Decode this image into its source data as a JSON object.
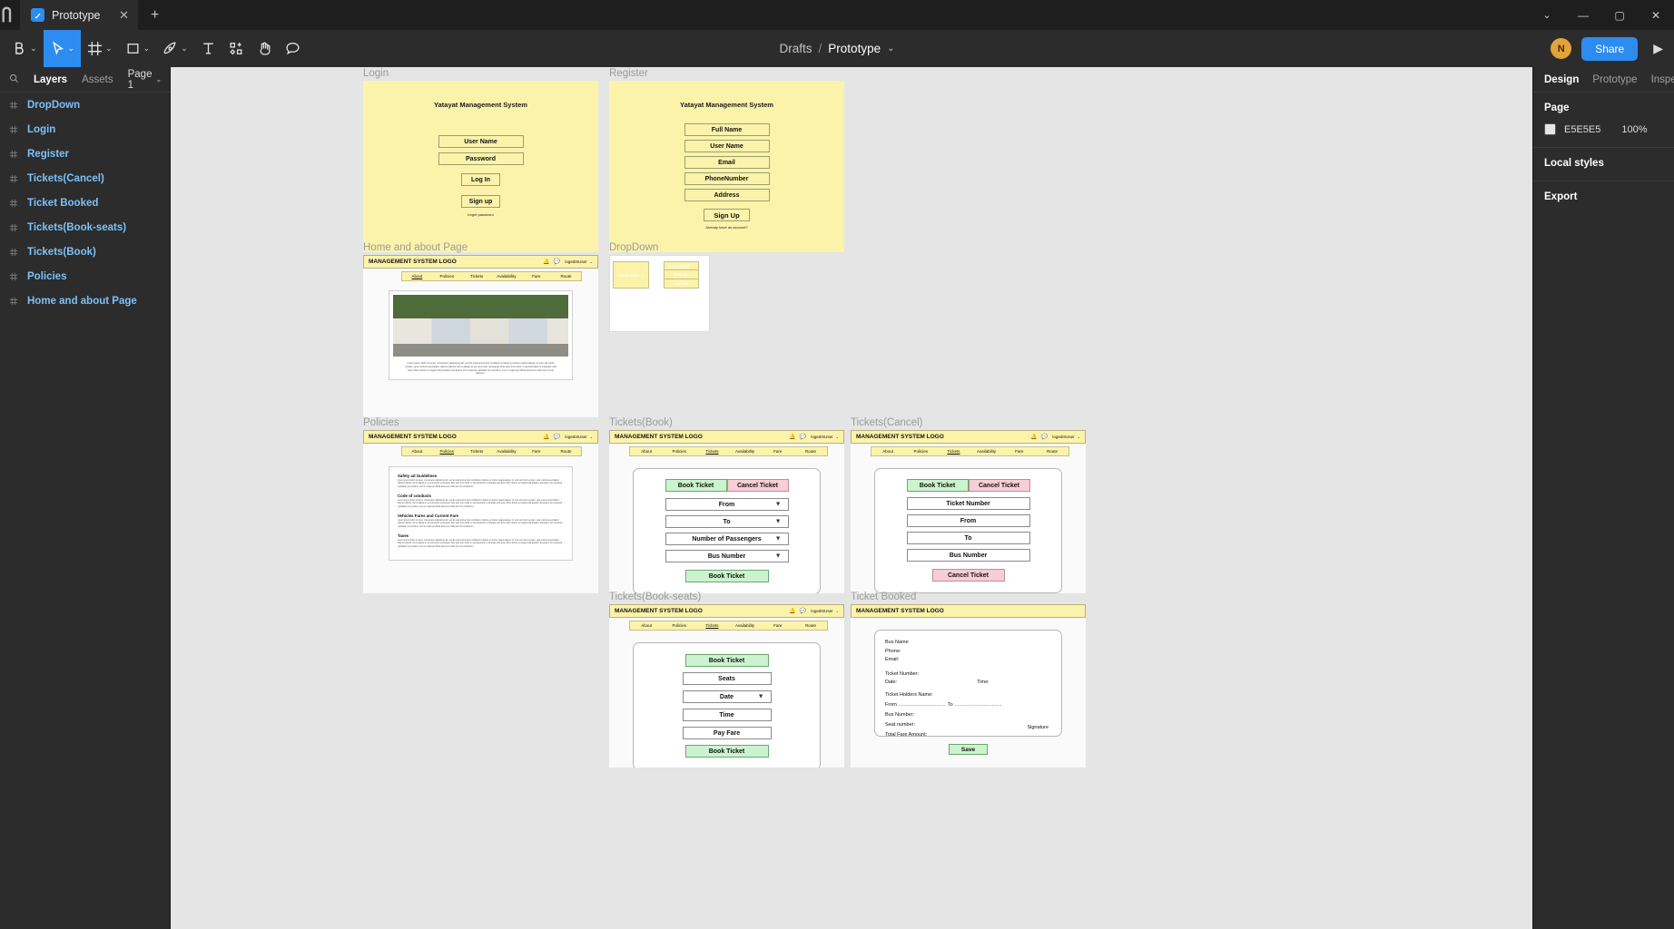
{
  "window": {
    "tab_title": "Prototype",
    "tab_icon": "figma-file-icon",
    "new_tab_icon": "plus-icon",
    "chevron_icon": "chevron-down-icon",
    "minimize_icon": "minimize-icon",
    "maximize_icon": "maximize-icon",
    "close_icon": "close-icon"
  },
  "toolbar": {
    "tools": [
      {
        "name": "move-tool",
        "icon": "cursor-icon",
        "active": true,
        "caret": true
      },
      {
        "name": "frame-tool",
        "icon": "frame-icon",
        "active": false,
        "caret": true
      },
      {
        "name": "shape-tool",
        "icon": "square-icon",
        "active": false,
        "caret": true
      },
      {
        "name": "pen-tool",
        "icon": "pen-icon",
        "active": false,
        "caret": true
      },
      {
        "name": "text-tool",
        "icon": "text-icon",
        "active": false,
        "caret": false
      },
      {
        "name": "component-tool",
        "icon": "components-icon",
        "active": false,
        "caret": false
      },
      {
        "name": "hand-tool",
        "icon": "hand-icon",
        "active": false,
        "caret": false
      },
      {
        "name": "comment-tool",
        "icon": "comment-icon",
        "active": false,
        "caret": false
      }
    ],
    "breadcrumb_root": "Drafts",
    "breadcrumb_sep": "/",
    "breadcrumb_file": "Prototype",
    "avatar_initial": "N",
    "share_label": "Share",
    "present_icon": "play-icon"
  },
  "left_panel": {
    "search_icon": "search-icon",
    "tabs": [
      {
        "label": "Layers",
        "selected": true
      },
      {
        "label": "Assets",
        "selected": false
      }
    ],
    "page_label": "Page 1",
    "layers": [
      {
        "label": "DropDown",
        "icon": "frame-icon"
      },
      {
        "label": "Login",
        "icon": "frame-icon"
      },
      {
        "label": "Register",
        "icon": "frame-icon"
      },
      {
        "label": "Tickets(Cancel)",
        "icon": "frame-icon"
      },
      {
        "label": "Ticket Booked",
        "icon": "frame-icon"
      },
      {
        "label": "Tickets(Book-seats)",
        "icon": "frame-icon"
      },
      {
        "label": "Tickets(Book)",
        "icon": "frame-icon"
      },
      {
        "label": "Policies",
        "icon": "frame-icon"
      },
      {
        "label": "Home and about Page",
        "icon": "frame-icon"
      }
    ]
  },
  "right_panel": {
    "tabs": [
      {
        "label": "Design",
        "selected": true
      },
      {
        "label": "Prototype",
        "selected": false
      },
      {
        "label": "Inspect",
        "selected": false
      }
    ],
    "page_heading": "Page",
    "page_color_hex": "E5E5E5",
    "page_color_value": "#E5E5E5",
    "page_opacity": "100%",
    "local_styles_heading": "Local styles",
    "export_heading": "Export"
  },
  "canvas": {
    "background": "#E5E5E5",
    "frames": {
      "login": {
        "label": "Login",
        "title": "Yatayat Management System",
        "fields": [
          "User Name",
          "Password"
        ],
        "login_button": "Log In",
        "signup_button": "Sign up",
        "forgot_link": "forget password"
      },
      "register": {
        "label": "Register",
        "title": "Yatayat Management System",
        "fields": [
          "Full Name",
          "User Name",
          "Email",
          "PhoneNumber",
          "Address"
        ],
        "signup_button": "Sign Up",
        "note": "Already have an account?"
      },
      "dropdown": {
        "label": "DropDown",
        "user_chip": "logedInUser",
        "user_chip_open": "logedInUser",
        "menu_items": [
          "Settings",
          "Log Out"
        ],
        "chevron_down_icon": "chevron-down-icon",
        "chevron_up_icon": "chevron-up-icon"
      },
      "home": {
        "label": "Home and about Page",
        "logo": "MANAGEMENT SYSTEM LOGO",
        "user": "logedInUser",
        "bell_icon": "bell-icon",
        "message_icon": "message-icon",
        "menu": [
          "About",
          "Policies",
          "Tickets",
          "Availability",
          "Fare",
          "Route"
        ],
        "active_menu": "About",
        "image_alt": "bus-fleet-photo",
        "body_text": "Lorem ipsum dolor sit amet, consectetur adipiscing elit, sed do eiusmod tempor incididunt ut labore et dolore magna aliqua. Ut enim ad minim veniam, quis nostrud exercitation ullamco laboris nisi ut aliquip ex ea commodo consequat. Duis aute irure dolor in reprehenderit in voluptate velit esse cillum dolore eu fugiat nulla pariatur. Excepteur sint occaecat cupidatat non proident, sunt in culpa qui officia deserunt mollit anim id est laborum."
      },
      "policies": {
        "label": "Policies",
        "logo": "MANAGEMENT SYSTEM LOGO",
        "user": "logedInUser",
        "menu": [
          "About",
          "Policies",
          "Tickets",
          "Availability",
          "Fare",
          "Route"
        ],
        "active_menu": "Policies",
        "sections": [
          {
            "heading": "Safety ad Guidelines",
            "body": "Lorem ipsum dolor sit amet, consectetur adipiscing elit, sed do eiusmod tempor incididunt ut labore et dolore magna aliqua. Ut enim ad minim veniam, quis nostrud exercitation ullamco laboris nisi ut aliquip ex ea commodo consequat. Duis aute irure dolor in reprehenderit in voluptate velit esse cillum dolore eu fugiat nulla pariatur. Excepteur sint occaecat cupidatat non proident, sunt in culpa qui officia deserunt mollit anim id est laborum."
          },
          {
            "heading": "Code of conducts",
            "body": "Lorem ipsum dolor sit amet, consectetur adipiscing elit, sed do eiusmod tempor incididunt ut labore et dolore magna aliqua. Ut enim ad minim veniam, quis nostrud exercitation ullamco laboris nisi ut aliquip ex ea commodo consequat. Duis aute irure dolor in reprehenderit in voluptate velit esse cillum dolore eu fugiat nulla pariatur. Excepteur sint occaecat cupidatat non proident, sunt in culpa qui officia deserunt mollit anim id est laborum."
          },
          {
            "heading": "Vehicles Fares and Current Fare",
            "body": "Lorem ipsum dolor sit amet, consectetur adipiscing elit, sed do eiusmod tempor incididunt ut labore et dolore magna aliqua. Ut enim ad minim veniam, quis nostrud exercitation ullamco laboris nisi ut aliquip ex ea commodo consequat. Duis aute irure dolor in reprehenderit in voluptate velit esse cillum dolore eu fugiat nulla pariatur. Excepteur sint occaecat cupidatat non proident, sunt in culpa qui officia deserunt mollit anim id est laborum."
          },
          {
            "heading": "Taxes",
            "body": "Lorem ipsum dolor sit amet, consectetur adipiscing elit, sed do eiusmod tempor incididunt ut labore et dolore magna aliqua. Ut enim ad minim veniam, quis nostrud exercitation ullamco laboris nisi ut aliquip ex ea commodo consequat. Duis aute irure dolor in reprehenderit in voluptate velit esse cillum dolore eu fugiat nulla pariatur. Excepteur sint occaecat cupidatat non proident, sunt in culpa qui officia deserunt mollit anim id est laborum."
          }
        ]
      },
      "tickets_book": {
        "label": "Tickets(Book)",
        "logo": "MANAGEMENT SYSTEM LOGO",
        "user": "logedInUser",
        "menu": [
          "About",
          "Policies",
          "Tickets",
          "Availability",
          "Fare",
          "Route"
        ],
        "active_menu": "Tickets",
        "tab_book": "Book Ticket",
        "tab_cancel": "Cancel Ticket",
        "fields": [
          "From",
          "To",
          "Number of Passengers",
          "Bus Number"
        ],
        "submit": "Book Ticket"
      },
      "tickets_cancel": {
        "label": "Tickets(Cancel)",
        "logo": "MANAGEMENT SYSTEM LOGO",
        "user": "logedInUser",
        "menu": [
          "About",
          "Policies",
          "Tickets",
          "Availability",
          "Fare",
          "Route"
        ],
        "active_menu": "Tickets",
        "tab_book": "Book Ticket",
        "tab_cancel": "Cancel Ticket",
        "fields": [
          "Ticket Number",
          "From",
          "To",
          "Bus Number"
        ],
        "submit": "Cancel Ticket"
      },
      "tickets_book_seats": {
        "label": "Tickets(Book-seats)",
        "logo": "MANAGEMENT SYSTEM LOGO",
        "user": "logedInUser",
        "menu": [
          "About",
          "Policies",
          "Tickets",
          "Availability",
          "Fare",
          "Route"
        ],
        "active_menu": "Tickets",
        "tab_book": "Book Ticket",
        "fields": [
          "Seats",
          "Date",
          "Time",
          "Pay Fare"
        ],
        "submit": "Book Ticket"
      },
      "ticket_booked": {
        "label": "Ticket Booked",
        "logo": "MANAGEMENT SYSTEM LOGO",
        "lines": [
          "Bus Name",
          "Phone:",
          "Email:"
        ],
        "ticket_number": "Ticket Number:",
        "date": "Date:",
        "time": "Time:",
        "holders_name": "Ticket Holders Name:",
        "from_label": "From",
        "from_dots": "..................................",
        "to_label": "To",
        "to_dots": "..................................",
        "bus_number": "Bus Number:",
        "seat_number": "Seat number:",
        "total_fare": "Total Fare Amount:",
        "signature": "Signature",
        "save_button": "Save"
      }
    }
  }
}
